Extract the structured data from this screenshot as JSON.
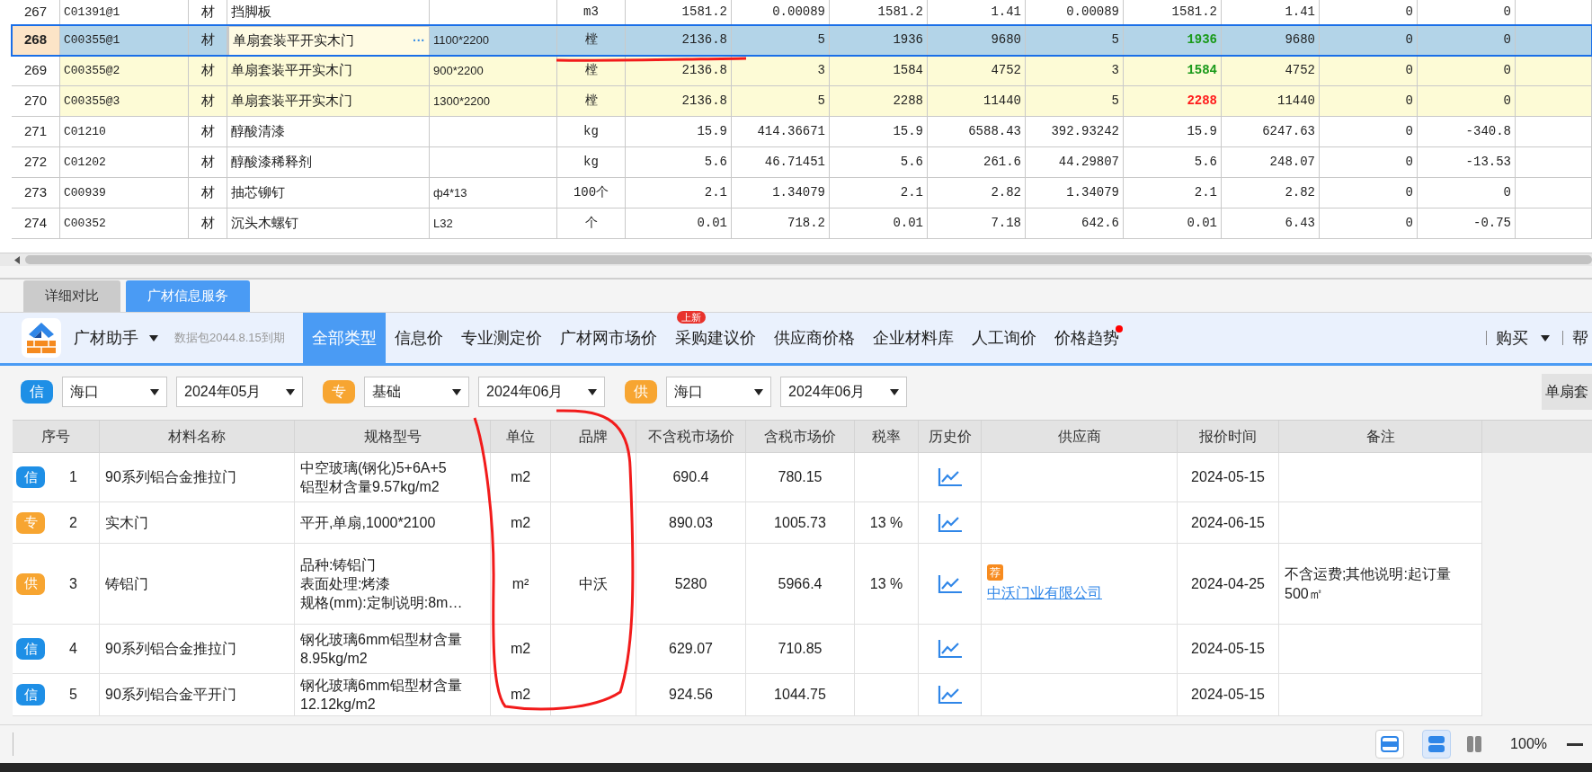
{
  "grid": {
    "rows": [
      {
        "no": "267",
        "code": "C01391@1",
        "type": "材",
        "name": "挡脚板",
        "unit": "m3",
        "values": [
          "1581.2",
          "0.00089",
          "1581.2",
          "1.41",
          "0.00089",
          "1581.2",
          "1.41",
          "0",
          "0"
        ],
        "selected": false,
        "grouped": false
      },
      {
        "no": "268",
        "code": "C00355@1",
        "type": "材",
        "name": "单扇套装平开实木门",
        "name_button": "···",
        "spec": "1100*2200",
        "unit": "樘",
        "values": [
          "2136.8",
          "5",
          "1936",
          "9680",
          "5",
          "1936",
          "9680",
          "0",
          "0"
        ],
        "selected": true,
        "grouped": true,
        "price_mark": {
          "color": "#1a9a1a"
        }
      },
      {
        "no": "269",
        "code": "C00355@2",
        "type": "材",
        "name": "单扇套装平开实木门",
        "spec": "900*2200",
        "unit": "樘",
        "values": [
          "2136.8",
          "3",
          "1584",
          "4752",
          "3",
          "1584",
          "4752",
          "0",
          "0"
        ],
        "selected": false,
        "grouped": true,
        "price_mark": {
          "color": "#1a9a1a"
        }
      },
      {
        "no": "270",
        "code": "C00355@3",
        "type": "材",
        "name": "单扇套装平开实木门",
        "spec": "1300*2200",
        "unit": "樘",
        "values": [
          "2136.8",
          "5",
          "2288",
          "11440",
          "5",
          "2288",
          "11440",
          "0",
          "0"
        ],
        "selected": false,
        "grouped": true,
        "price_mark": {
          "color": "#ff1a1a"
        }
      },
      {
        "no": "271",
        "code": "C01210",
        "type": "材",
        "name": "醇酸清漆",
        "unit": "kg",
        "values": [
          "15.9",
          "414.36671",
          "15.9",
          "6588.43",
          "392.93242",
          "15.9",
          "6247.63",
          "0",
          "-340.8"
        ],
        "selected": false,
        "grouped": false
      },
      {
        "no": "272",
        "code": "C01202",
        "type": "材",
        "name": "醇酸漆稀释剂",
        "unit": "kg",
        "values": [
          "5.6",
          "46.71451",
          "5.6",
          "261.6",
          "44.29807",
          "5.6",
          "248.07",
          "0",
          "-13.53"
        ],
        "selected": false,
        "grouped": false
      },
      {
        "no": "273",
        "code": "C00939",
        "type": "材",
        "name": "抽芯铆钉",
        "spec": "ф4*13",
        "unit": "100个",
        "values": [
          "2.1",
          "1.34079",
          "2.1",
          "2.82",
          "1.34079",
          "2.1",
          "2.82",
          "0",
          "0"
        ],
        "selected": false,
        "grouped": false
      },
      {
        "no": "274",
        "code": "C00352",
        "type": "材",
        "name": "沉头木螺钉",
        "spec": "L32",
        "unit": "个",
        "values": [
          "0.01",
          "718.2",
          "0.01",
          "7.18",
          "642.6",
          "0.01",
          "6.43",
          "0",
          "-0.75"
        ],
        "selected": false,
        "grouped": false
      }
    ]
  },
  "panel": {
    "tabs": [
      {
        "label": "详细对比",
        "selected": false
      },
      {
        "label": "广材信息服务",
        "selected": true
      }
    ],
    "assistant": {
      "name": "广材助手",
      "package_note": "数据包2044.8.15到期"
    },
    "categories": [
      {
        "label": "全部类型",
        "selected": true,
        "dot": false
      },
      {
        "label": "信息价",
        "selected": false,
        "dot": false
      },
      {
        "label": "专业测定价",
        "selected": false,
        "dot": false
      },
      {
        "label": "广材网市场价",
        "selected": false,
        "dot": false
      },
      {
        "label": "采购建议价",
        "selected": false,
        "dot": false,
        "badge": "上新"
      },
      {
        "label": "供应商价格",
        "selected": false,
        "dot": false
      },
      {
        "label": "企业材料库",
        "selected": false,
        "dot": false
      },
      {
        "label": "人工询价",
        "selected": false,
        "dot": false
      },
      {
        "label": "价格趋势",
        "selected": false,
        "dot": true
      }
    ],
    "menu": [
      {
        "label": "购买",
        "dropdown": true
      },
      {
        "label": "帮",
        "dropdown": false
      }
    ],
    "filters": [
      {
        "kind": "badge",
        "label": "信",
        "color": "#1e8fe6"
      },
      {
        "kind": "select",
        "value": "海口"
      },
      {
        "kind": "select",
        "value": "2024年05月"
      },
      {
        "kind": "badge",
        "label": "专",
        "color": "#f7a531"
      },
      {
        "kind": "select",
        "value": "基础"
      },
      {
        "kind": "select",
        "value": "2024年06月"
      },
      {
        "kind": "badge",
        "label": "供",
        "color": "#f7a531"
      },
      {
        "kind": "select",
        "value": "海口"
      },
      {
        "kind": "select",
        "value": "2024年06月"
      }
    ],
    "filter_button": "单扇套",
    "table": {
      "columns": [
        "序号",
        "材料名称",
        "规格型号",
        "单位",
        "品牌",
        "不含税市场价",
        "含税市场价",
        "税率",
        "历史价",
        "供应商",
        "报价时间",
        "备注"
      ],
      "rows": [
        {
          "source": {
            "label": "信",
            "color": "#1e8fe6"
          },
          "no": "1",
          "name": "90系列铝合金推拉门",
          "spec": [
            "中空玻璃(钢化)5+6A+5",
            "铝型材含量9.57kg/m2"
          ],
          "unit": "m2",
          "price_ex": "690.4",
          "price_in": "780.15",
          "date": "2024-05-15"
        },
        {
          "source": {
            "label": "专",
            "color": "#f7a531"
          },
          "no": "2",
          "name": "实木门",
          "spec": [
            "平开,单扇,1000*2100"
          ],
          "unit": "m2",
          "price_ex": "890.03",
          "price_in": "1005.73",
          "tax": "13 %",
          "date": "2024-06-15"
        },
        {
          "source": {
            "label": "供",
            "color": "#f7a531"
          },
          "no": "3",
          "name": "铸铝门",
          "spec": [
            "品种:铸铝门",
            "表面处理:烤漆",
            "规格(mm):定制说明:8m…"
          ],
          "unit": "m²",
          "brand": "中沃",
          "price_ex": "5280",
          "price_in": "5966.4",
          "tax": "13 %",
          "supplier_tag": "荐",
          "supplier": "中沃门业有限公司",
          "date": "2024-04-25",
          "note": [
            "不含运费;其他说明:起订量",
            "500㎡"
          ]
        },
        {
          "source": {
            "label": "信",
            "color": "#1e8fe6"
          },
          "no": "4",
          "name": "90系列铝合金推拉门",
          "spec": [
            "钢化玻璃6mm铝型材含量",
            "8.95kg/m2"
          ],
          "unit": "m2",
          "price_ex": "629.07",
          "price_in": "710.85",
          "date": "2024-05-15"
        },
        {
          "source": {
            "label": "信",
            "color": "#1e8fe6"
          },
          "no": "5",
          "name": "90系列铝合金平开门",
          "spec": [
            "钢化玻璃6mm铝型材含量",
            "12.12kg/m2"
          ],
          "unit": "m2",
          "price_ex": "924.56",
          "price_in": "1044.75",
          "date": "2024-05-15"
        }
      ]
    }
  },
  "status": {
    "views": [
      {
        "kind": "single",
        "selected": false
      },
      {
        "kind": "stacked",
        "selected": true
      },
      {
        "kind": "columns",
        "selected": false
      }
    ],
    "zoom": "100%"
  }
}
